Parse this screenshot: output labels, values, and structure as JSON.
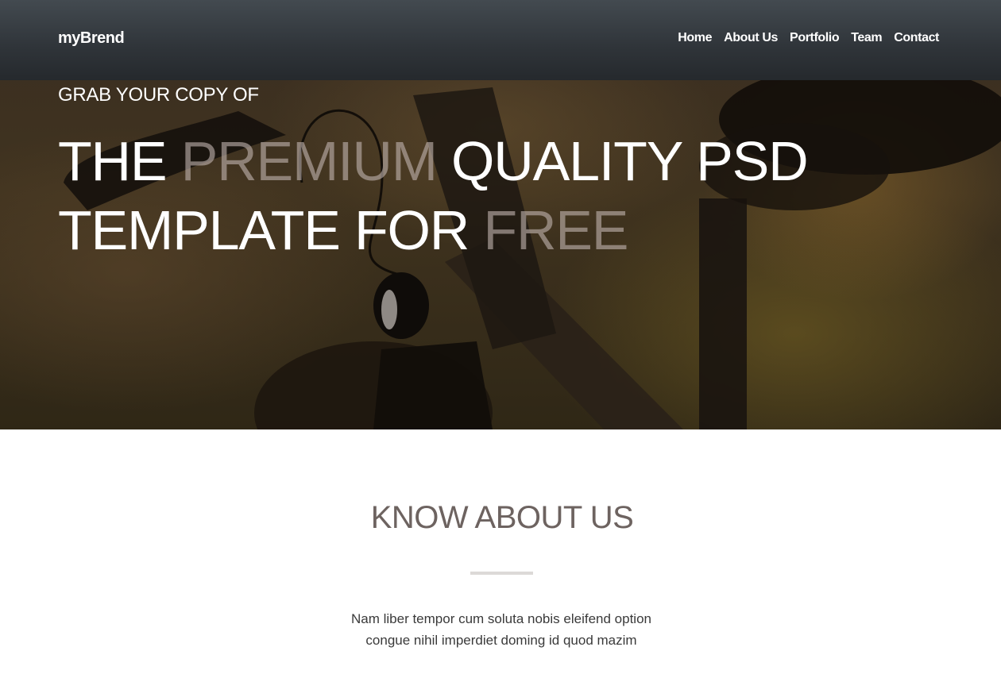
{
  "header": {
    "brand": "myBrend",
    "nav": [
      {
        "label": "Home"
      },
      {
        "label": "About Us"
      },
      {
        "label": "Portfolio"
      },
      {
        "label": "Team"
      },
      {
        "label": "Contact"
      }
    ]
  },
  "hero": {
    "kicker": "GRAB YOUR COPY OF",
    "headline": {
      "line1_part1": "THE ",
      "line1_highlight": "PREMIUM",
      "line1_part2": " QUALITY PSD",
      "line2_part1": "TEMPLATE FOR ",
      "line2_highlight": "FREE"
    },
    "background_icon": "bicycle-photo"
  },
  "about": {
    "title": "KNOW ABOUT US",
    "text_line1": "Nam liber tempor cum soluta nobis eleifend option",
    "text_line2": "congue nihil imperdiet doming id quod mazim"
  },
  "colors": {
    "header_bg": "#2f3439",
    "accent_faded": "#beb2ac",
    "section_title": "#6d6360",
    "divider": "#dcd9d7"
  }
}
